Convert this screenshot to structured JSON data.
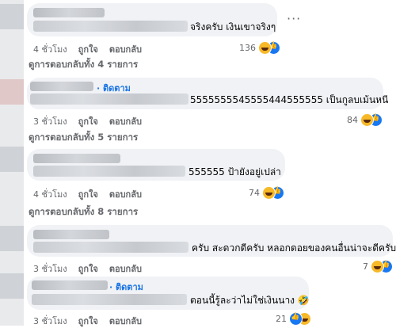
{
  "follow_label": "· ติดตาม",
  "more_icon": "more-horizontal-icon",
  "comments": [
    {
      "text": "จริงครับ เงินเขาจริงๆ",
      "time": "4 ชั่วโมง",
      "like": "ถูกใจ",
      "reply": "ตอบกลับ",
      "reaction_count": "136",
      "replies_label": "ดูการตอบกลับทั้ง 4 รายการ"
    },
    {
      "text": "5555555545555444555555 เป็นกูลบเม้นหนี",
      "follow": true,
      "time": "3 ชั่วโมง",
      "like": "ถูกใจ",
      "reply": "ตอบกลับ",
      "reaction_count": "84",
      "replies_label": "ดูการตอบกลับทั้ง 5 รายการ"
    },
    {
      "text": "555555 ป้ายังอยู่เปล่า",
      "time": "4 ชั่วโมง",
      "like": "ถูกใจ",
      "reply": "ตอบกลับ",
      "reaction_count": "74",
      "replies_label": "ดูการตอบกลับทั้ง 8 รายการ"
    },
    {
      "text": "ครับ สะดวกดีครับ หลอกดอยของคนอื่นน่าจะดีครับ",
      "time": "3 ชั่วโมง",
      "like": "ถูกใจ",
      "reply": "ตอบกลับ",
      "reaction_count": "7"
    },
    {
      "text": "ตอนนี้รู้ละว่าไม่ใช่เงินนาง 🤣",
      "follow": true,
      "time": "3 ชั่วโมง",
      "like": "ถูกใจ",
      "reply": "ตอบกลับ",
      "reaction_count": "21"
    }
  ]
}
